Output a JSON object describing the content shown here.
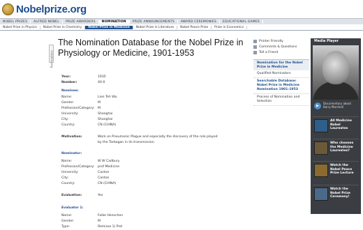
{
  "header": {
    "logo_text": "Nobelprize.org",
    "nav_primary": [
      "NOBEL PRIZES",
      "ALFRED NOBEL",
      "PRIZE AWARDERS",
      "NOMINATION",
      "PRIZE ANNOUNCEMENTS",
      "AWARD CEREMONIES",
      "EDUCATIONAL GAMES"
    ],
    "nav_secondary": [
      "Nobel Prize in Physics",
      "Nobel Prize in Chemistry",
      "Nobel Prize in Medicine",
      "Nobel Prize in Literature",
      "Nobel Peace Prize",
      "Prize in Economics"
    ]
  },
  "side_tab": "Nominations",
  "title": "The Nomination Database for the Nobel Prize in Physiology or Medicine, 1901-1953",
  "record": [
    {
      "k": "Year:",
      "v": "1935",
      "style": "b"
    },
    {
      "k": "Number:",
      "v": "40-0",
      "style": "b"
    },
    {
      "k": "Nominee:",
      "v": "",
      "style": "sec"
    },
    {
      "k": "Name:",
      "v": "Lien Teh Wu",
      "style": ""
    },
    {
      "k": "Gender:",
      "v": "M",
      "style": ""
    },
    {
      "k": "Profession/Category:",
      "v": "M",
      "style": ""
    },
    {
      "k": "University:",
      "v": "Shanghai",
      "style": ""
    },
    {
      "k": "City:",
      "v": "Shanghai",
      "style": ""
    },
    {
      "k": "Country:",
      "v": "CN (CHINA)",
      "style": ""
    },
    {
      "k": "Motivation:",
      "v": "Work on Pneumonic Plague and especially the discovery of the role played",
      "style": "b"
    },
    {
      "k": "",
      "v": "by the Tarbagan in its transmission.",
      "style": ""
    },
    {
      "k": "Nominator:",
      "v": "",
      "style": "sec"
    },
    {
      "k": "Name:",
      "v": "W W Cadbury",
      "style": ""
    },
    {
      "k": "Profession/Category:",
      "v": "prof Medicine",
      "style": ""
    },
    {
      "k": "University:",
      "v": "Canton",
      "style": ""
    },
    {
      "k": "City:",
      "v": "Canton",
      "style": ""
    },
    {
      "k": "Country:",
      "v": "CN (CHINA)",
      "style": ""
    },
    {
      "k": "Evaluation:",
      "v": "Yes",
      "style": "b"
    },
    {
      "k": "Evaluator 1:",
      "v": "",
      "style": "sec"
    },
    {
      "k": "Name:",
      "v": "Folke Henschen",
      "style": ""
    },
    {
      "k": "Gender:",
      "v": "M",
      "style": ""
    },
    {
      "k": "Type:",
      "v": "Remisse 1) Prel",
      "style": ""
    }
  ],
  "utilities": [
    "Printer Friendly",
    "Comments & Questions",
    "Tell a Friend"
  ],
  "sidebar": {
    "head": "Nomination for the Nobel Prize in Medicine",
    "links": [
      {
        "label": "Qualified Nominators",
        "bold": false
      },
      {
        "label": "Searchable Database: Nobel Prize in Medicine Nomination 1901-1953",
        "bold": true
      },
      {
        "label": "Process of Nomination and Selection",
        "bold": false
      }
    ]
  },
  "media": {
    "title": "Media Player",
    "caption": "Documentary about Barry Marshall",
    "tiles": [
      {
        "label": "All Medicine Nobel Laureates",
        "color": "#2e5f8a"
      },
      {
        "label": "Who chooses the Medicine Laureates?",
        "color": "#6b5a3a"
      },
      {
        "label": "Watch the Nobel Peace Prize Lecture",
        "color": "#8a6a2e"
      },
      {
        "label": "Watch the Nobel Prize Ceremony!",
        "color": "#4a6a8a"
      }
    ]
  }
}
